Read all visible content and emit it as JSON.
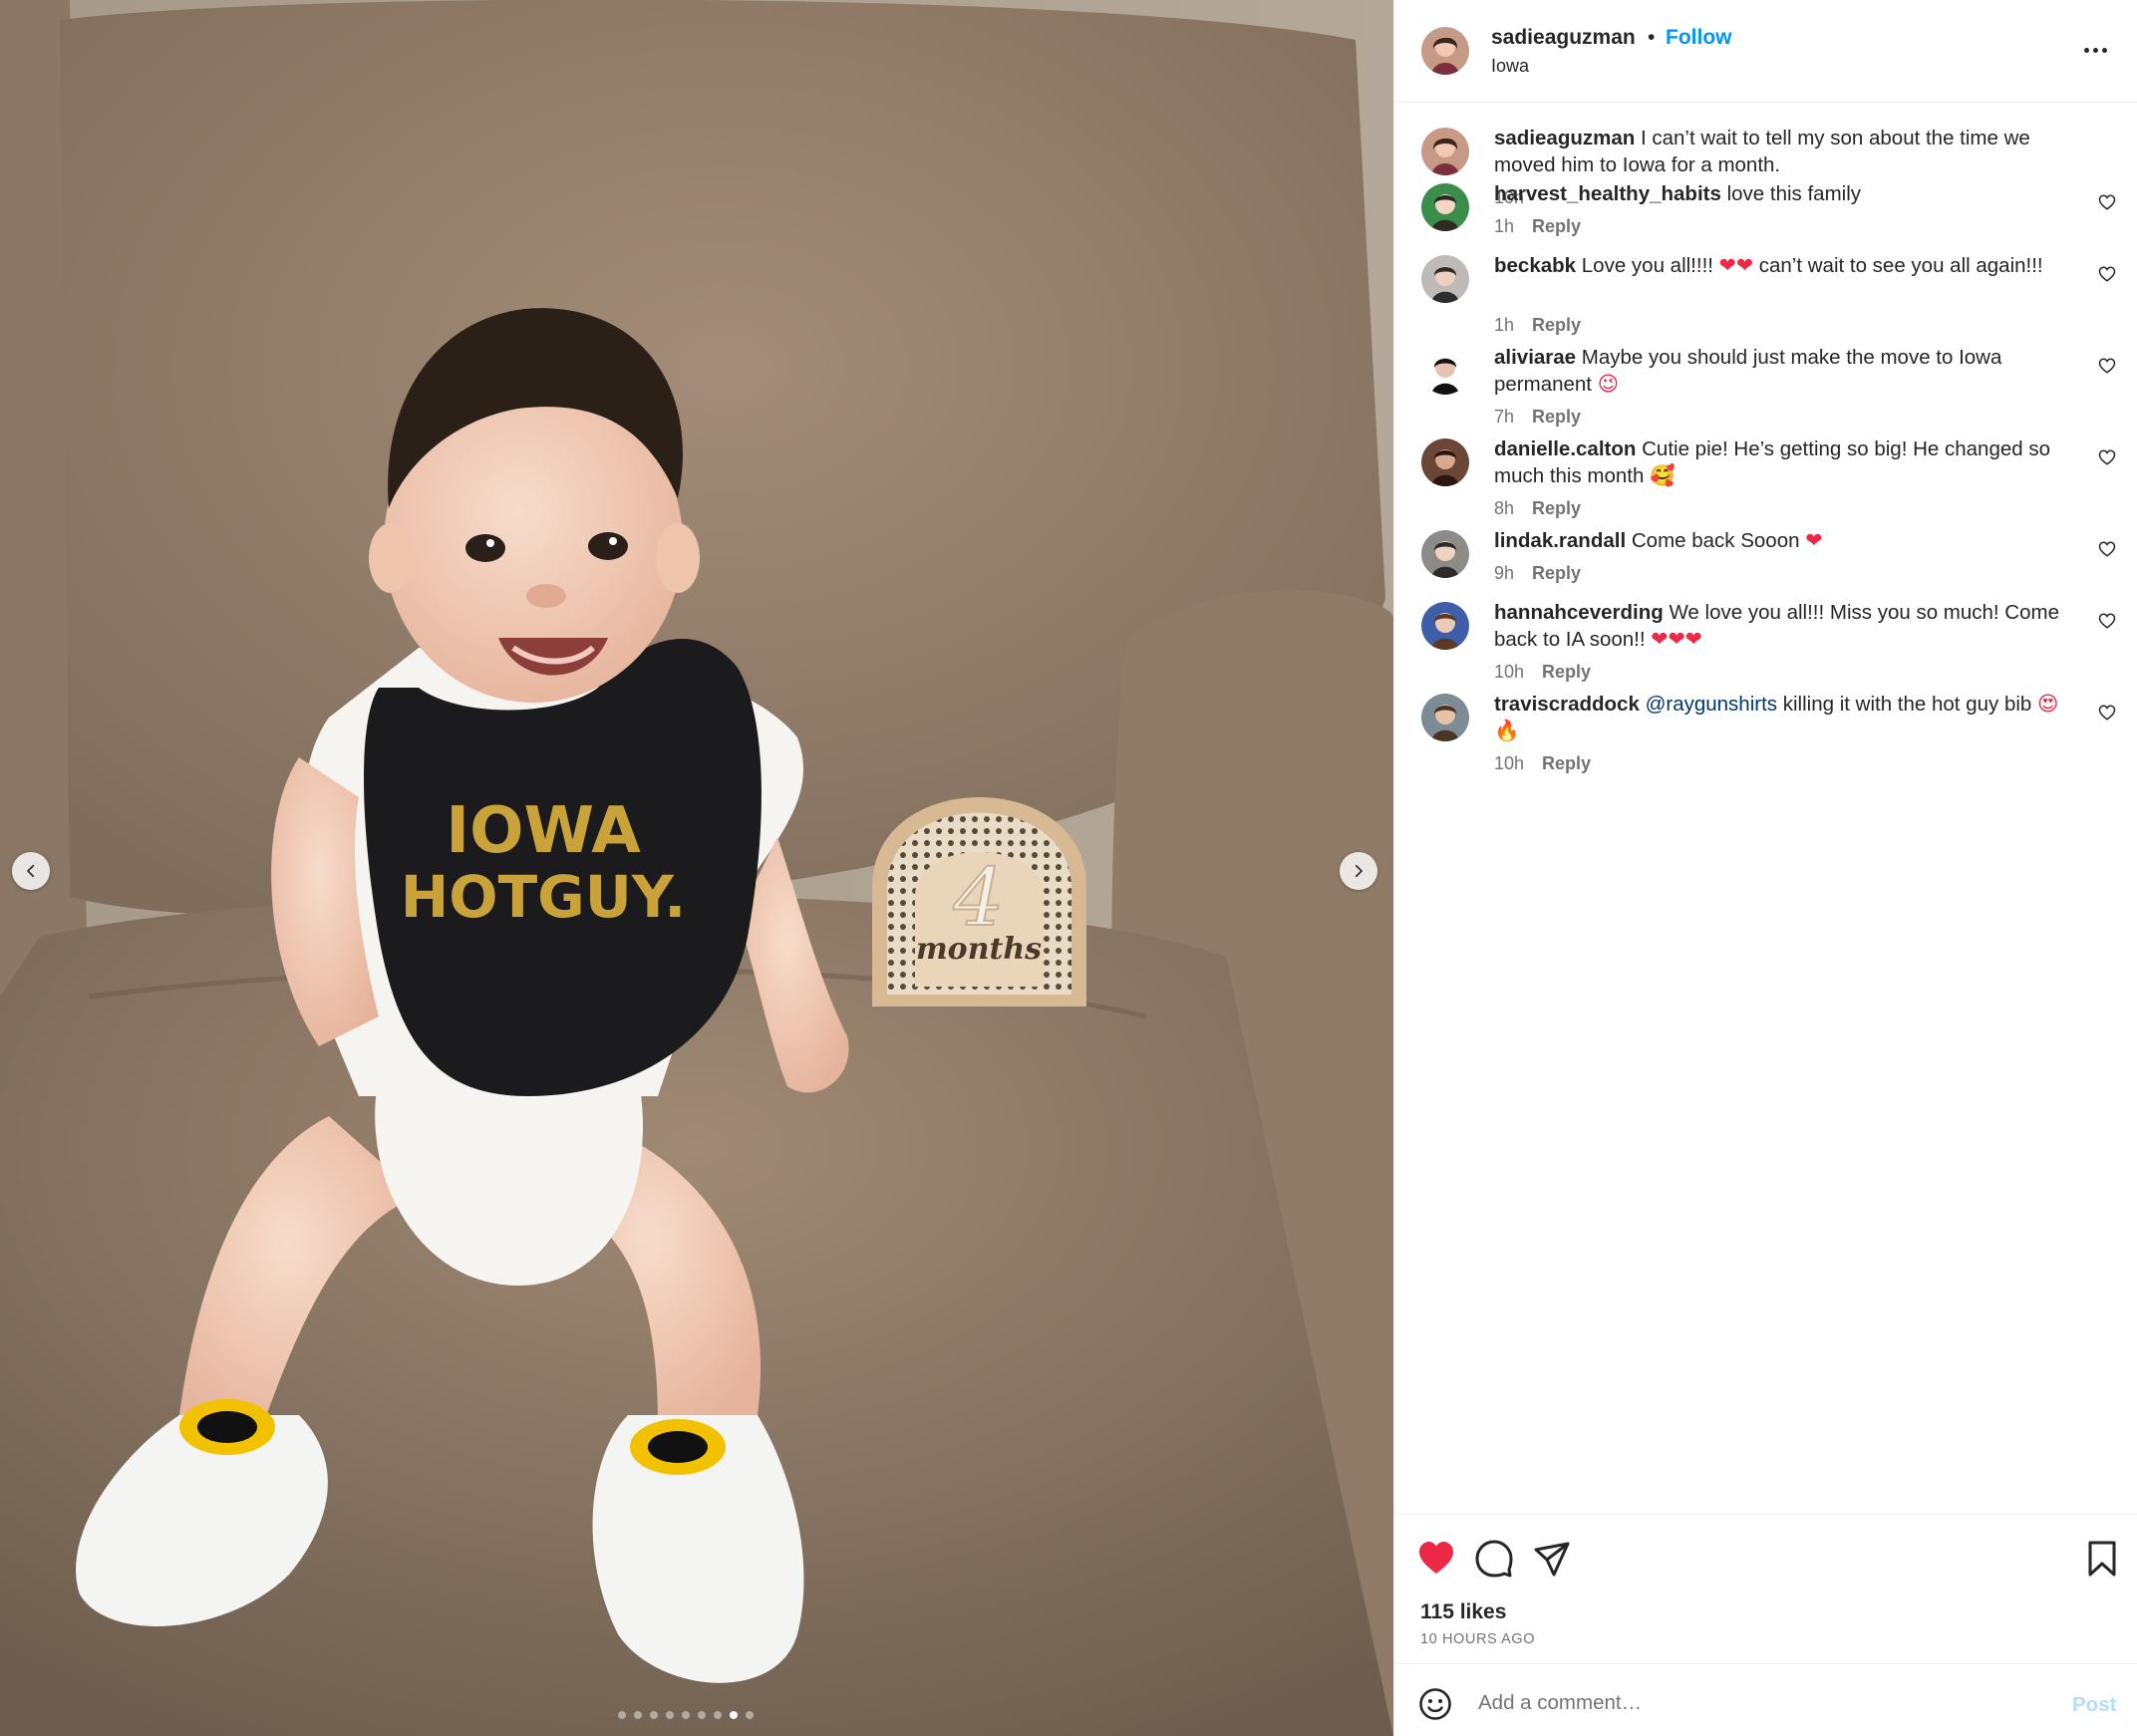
{
  "post": {
    "username": "sadieaguzman",
    "separator": "•",
    "follow_label": "Follow",
    "location": "Iowa",
    "caption": {
      "username": "sadieaguzman",
      "text": "I can’t wait to tell my son about the time we moved him to Iowa for a month.",
      "time": "10h"
    },
    "image": {
      "bib_text_line1": "IOWA",
      "bib_text_line2": "HOTGUY.",
      "sign_number": "4",
      "sign_text": "months",
      "carousel_count": 9,
      "carousel_active_index": 7
    }
  },
  "comments": [
    {
      "username": "harvest_healthy_habits",
      "text_before": "love this family",
      "time": "1h",
      "reply": "Reply"
    },
    {
      "username": "beckabk",
      "text_before": "Love you all!!!!",
      "emoji": "❤❤",
      "text_after": "can’t wait to see you all again!!!",
      "time": "1h",
      "reply": "Reply"
    },
    {
      "username": "aliviarae",
      "text_before": "Maybe you should just make the move to Iowa permanent",
      "emoji": "😉",
      "time": "7h",
      "reply": "Reply"
    },
    {
      "username": "danielle.calton",
      "text_before": "Cutie pie! He’s getting so big! He changed so much this month",
      "emoji": "🥰",
      "time": "8h",
      "reply": "Reply"
    },
    {
      "username": "lindak.randall",
      "text_before": "Come back Sooon",
      "emoji": "❤",
      "time": "9h",
      "reply": "Reply"
    },
    {
      "username": "hannahceverding",
      "text_before": "We love you all!!! Miss you so much! Come back to IA soon!!",
      "emoji": "❤❤❤",
      "time": "10h",
      "reply": "Reply"
    },
    {
      "username": "traviscraddock",
      "mention": "@raygunshirts",
      "text_before": "killing it with the hot guy bib",
      "emoji": "😍🔥",
      "time": "10h",
      "reply": "Reply"
    }
  ],
  "actions": {
    "likes": "115 likes",
    "time_ago": "10 HOURS AGO",
    "like_icon": "heart-filled-icon",
    "comment_icon": "speech-bubble-icon",
    "share_icon": "paper-plane-icon",
    "save_icon": "bookmark-icon"
  },
  "add_comment": {
    "placeholder": "Add a comment…",
    "post_label": "Post"
  },
  "colors": {
    "accent": "#0095f6",
    "liked": "#ed2847",
    "muted": "#737373",
    "post_disabled": "#b2dffc"
  }
}
